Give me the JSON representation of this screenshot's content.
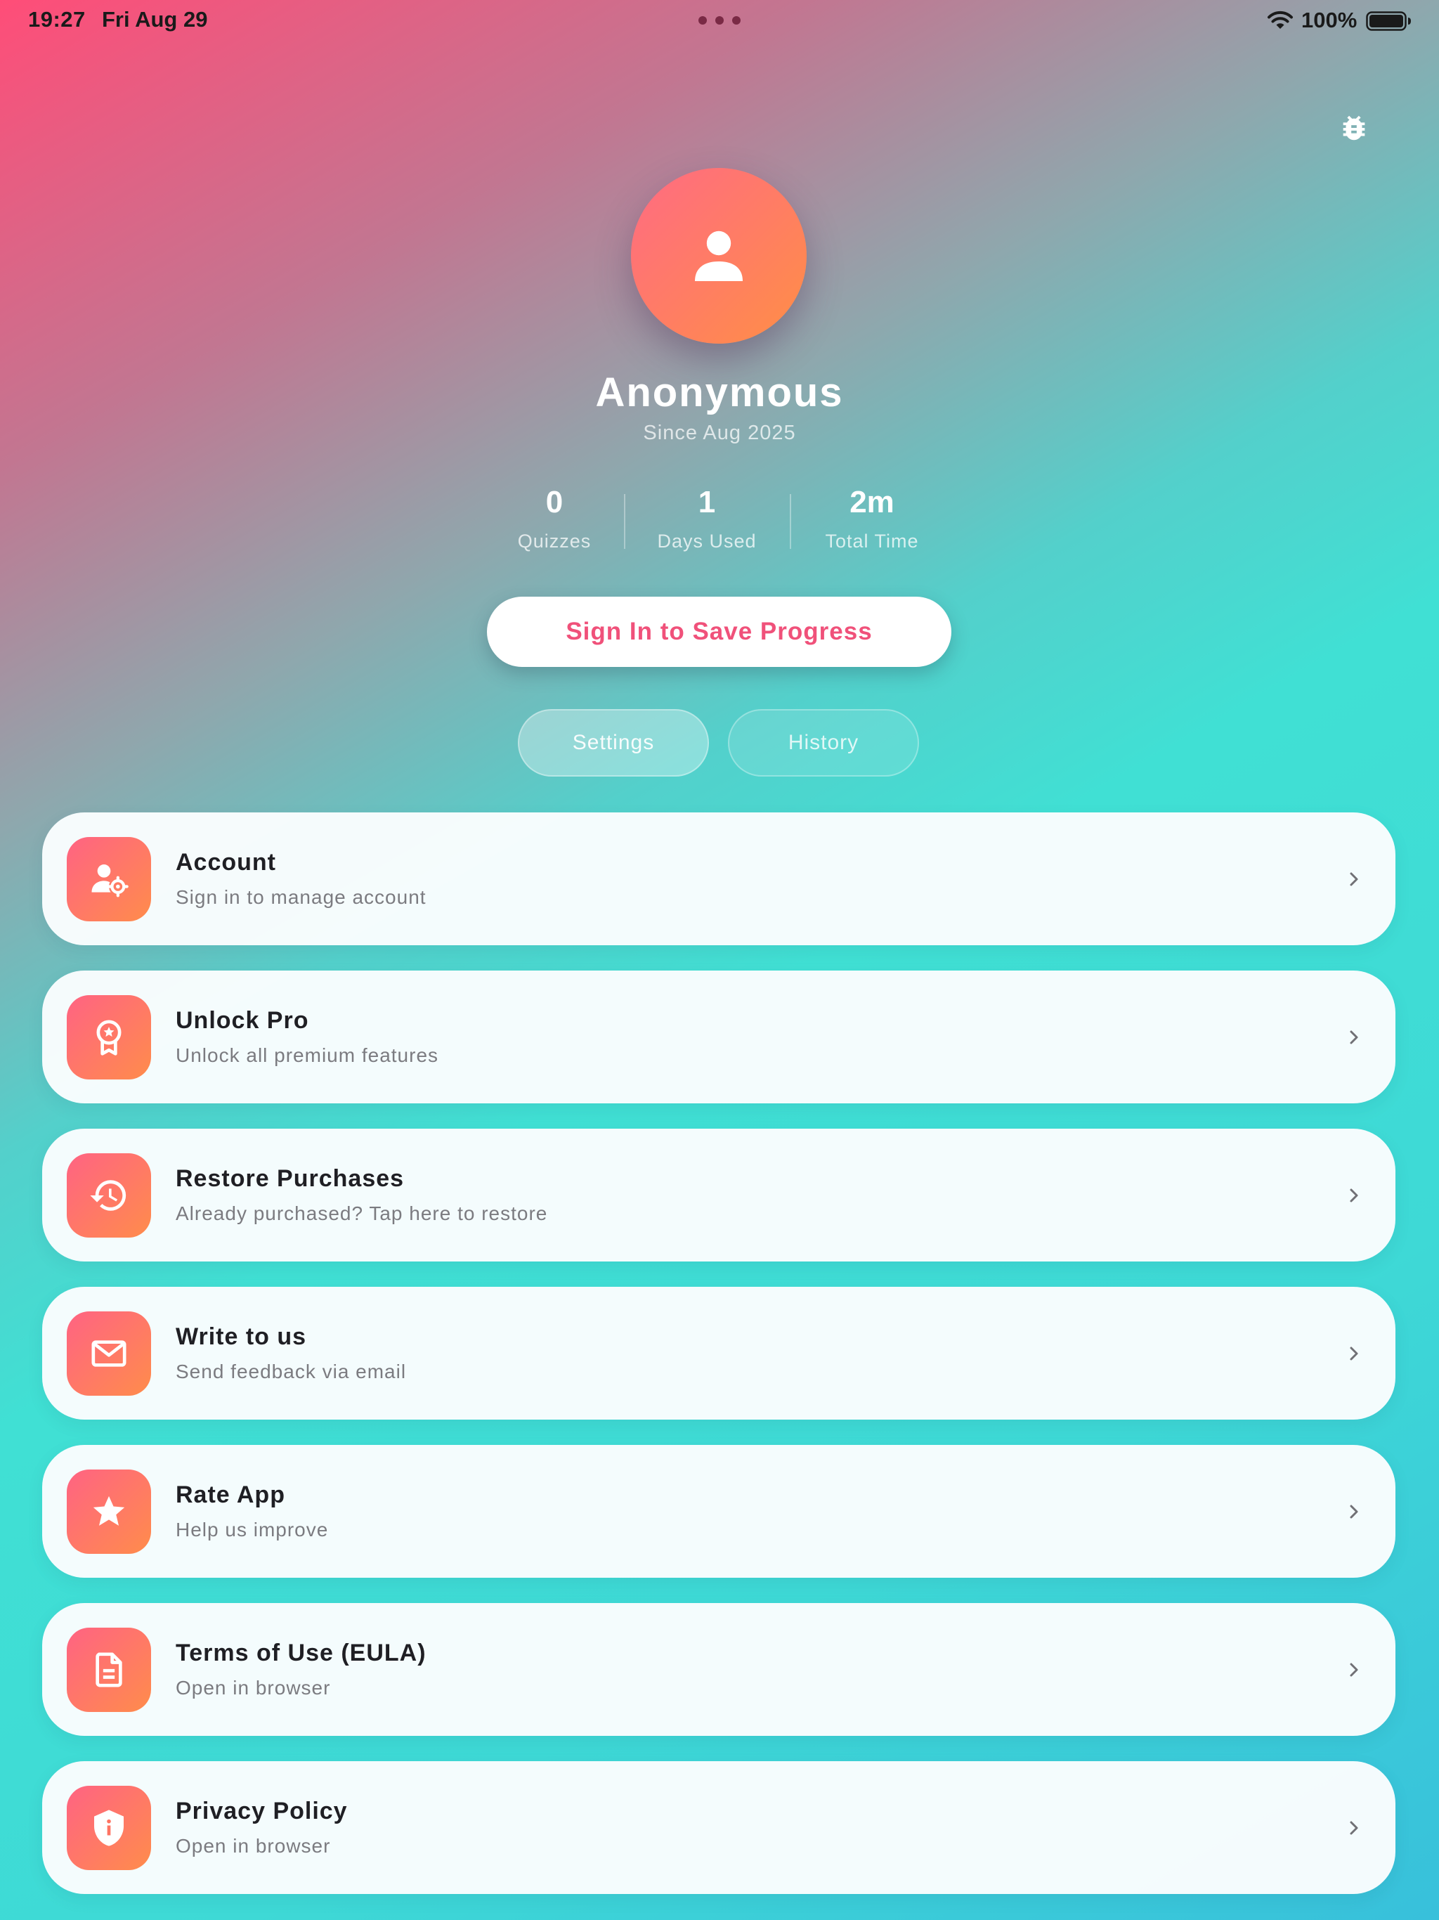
{
  "status_bar": {
    "time": "19:27",
    "date": "Fri Aug 29",
    "battery": "100%",
    "icons": [
      "wifi-icon",
      "battery-icon"
    ]
  },
  "header": {
    "debug_icon": "bug-icon"
  },
  "profile": {
    "name": "Anonymous",
    "since": "Since Aug 2025",
    "avatar_icon": "person-icon"
  },
  "stats": [
    {
      "value": "0",
      "label": "Quizzes"
    },
    {
      "value": "1",
      "label": "Days Used"
    },
    {
      "value": "2m",
      "label": "Total Time"
    }
  ],
  "signin": {
    "label": "Sign In to Save Progress"
  },
  "tabs": [
    {
      "label": "Settings",
      "selected": true
    },
    {
      "label": "History",
      "selected": false
    }
  ],
  "menu": [
    {
      "title": "Account",
      "subtitle": "Sign in to manage account",
      "icon": "user-gear-icon"
    },
    {
      "title": "Unlock Pro",
      "subtitle": "Unlock all premium features",
      "icon": "award-icon"
    },
    {
      "title": "Restore Purchases",
      "subtitle": "Already purchased? Tap here to restore",
      "icon": "history-icon"
    },
    {
      "title": "Write to us",
      "subtitle": "Send feedback via email",
      "icon": "mail-icon"
    },
    {
      "title": "Rate App",
      "subtitle": "Help us improve",
      "icon": "star-icon"
    },
    {
      "title": "Terms of Use (EULA)",
      "subtitle": "Open in browser",
      "icon": "document-icon"
    },
    {
      "title": "Privacy Policy",
      "subtitle": "Open in browser",
      "icon": "shield-icon"
    }
  ],
  "colors": {
    "accent": "#f0517a",
    "icon_gradient_start": "#ff6383",
    "icon_gradient_end": "#ff8c4b",
    "background_teal": "#40e0d4",
    "background_pink": "#ff4d78"
  }
}
